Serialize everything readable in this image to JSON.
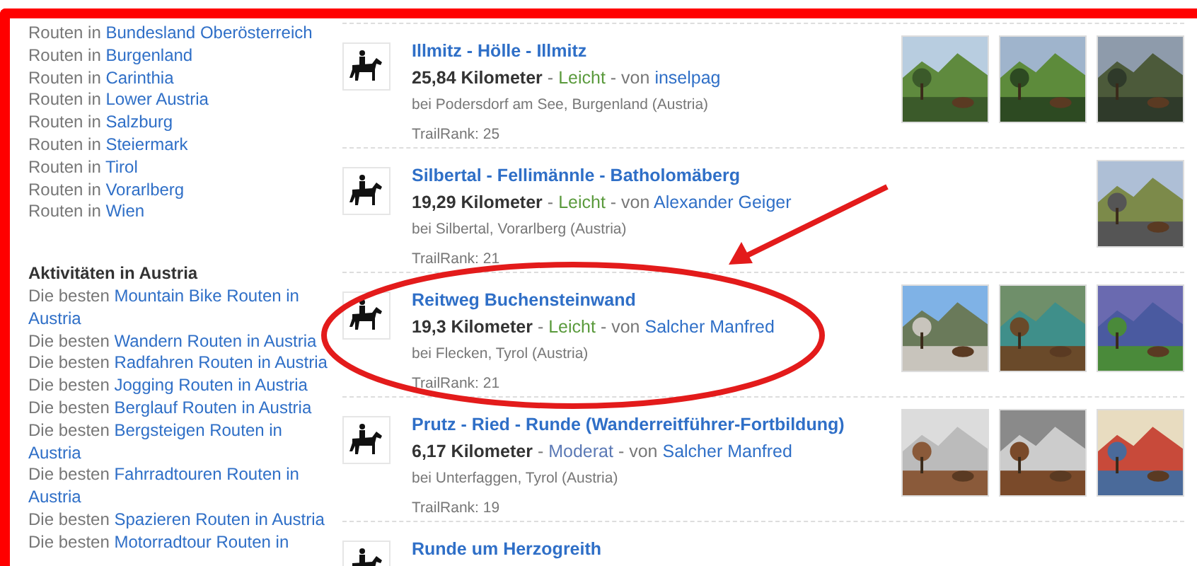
{
  "regions": [
    {
      "prefix": "Routen in",
      "link": "Bundesland Oberösterreich"
    },
    {
      "prefix": "Routen in",
      "link": "Burgenland"
    },
    {
      "prefix": "Routen in",
      "link": "Carinthia"
    },
    {
      "prefix": "Routen in",
      "link": "Lower Austria"
    },
    {
      "prefix": "Routen in",
      "link": "Salzburg"
    },
    {
      "prefix": "Routen in",
      "link": "Steiermark"
    },
    {
      "prefix": "Routen in",
      "link": "Tirol"
    },
    {
      "prefix": "Routen in",
      "link": "Vorarlberg"
    },
    {
      "prefix": "Routen in",
      "link": "Wien"
    }
  ],
  "activities": {
    "heading": "Aktivitäten in Austria",
    "items": [
      {
        "prefix": "Die besten",
        "link": "Mountain Bike Routen in Austria"
      },
      {
        "prefix": "Die besten",
        "link": "Wandern Routen in Austria"
      },
      {
        "prefix": "Die besten",
        "link": "Radfahren Routen in Austria"
      },
      {
        "prefix": "Die besten",
        "link": "Jogging Routen in Austria"
      },
      {
        "prefix": "Die besten",
        "link": "Berglauf Routen in Austria"
      },
      {
        "prefix": "Die besten",
        "link": "Bergsteigen Routen in Austria"
      },
      {
        "prefix": "Die besten",
        "link": "Fahrradtouren Routen in Austria"
      },
      {
        "prefix": "Die besten",
        "link": "Spazieren Routen in Austria"
      },
      {
        "prefix": "Die besten",
        "link": "Motorradtour Routen in"
      }
    ]
  },
  "routes": [
    {
      "title": "Illmitz - Hölle - Illmitz",
      "distance": "25,84 Kilometer",
      "dash": "-",
      "difficulty": {
        "label": "Leicht",
        "color": "#5a9a3c"
      },
      "by": "- von",
      "author": "inselpag",
      "location": "bei Podersdorf am See, Burgenland (Austria)",
      "rank": "TrailRank: 25",
      "highlighted": false
    },
    {
      "title": "Silbertal - Fellimännle - Batholomäberg",
      "distance": "19,29 Kilometer",
      "dash": "-",
      "difficulty": {
        "label": "Leicht",
        "color": "#5a9a3c"
      },
      "by": "- von",
      "author": "Alexander Geiger",
      "location": "bei Silbertal, Vorarlberg (Austria)",
      "rank": "TrailRank: 21",
      "highlighted": false
    },
    {
      "title": "Reitweg Buchensteinwand",
      "distance": "19,3 Kilometer",
      "dash": "-",
      "difficulty": {
        "label": "Leicht",
        "color": "#5a9a3c"
      },
      "by": "- von",
      "author": "Salcher Manfred",
      "location": "bei Flecken, Tyrol (Austria)",
      "rank": "TrailRank: 21",
      "highlighted": true
    },
    {
      "title": "Prutz - Ried - Runde (Wanderreitführer-Fortbildung)",
      "distance": "6,17 Kilometer",
      "dash": "-",
      "difficulty": {
        "label": "Moderat",
        "color": "#5b79b5"
      },
      "by": "- von",
      "author": "Salcher Manfred",
      "location": "bei Unterfaggen, Tyrol (Austria)",
      "rank": "TrailRank: 19",
      "highlighted": false
    },
    {
      "title": "Runde um Herzogreith"
    }
  ]
}
